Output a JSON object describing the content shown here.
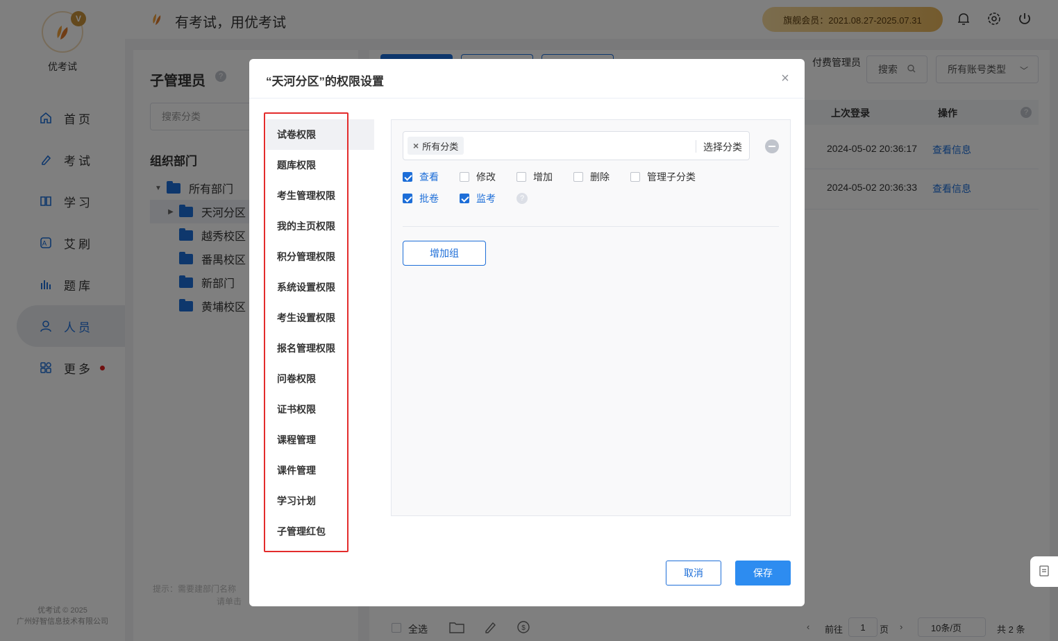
{
  "app": {
    "logo_text": "优考试",
    "logo_badge": "V",
    "slogan": "有考试，用优考试",
    "vip_text": "旗舰会员：2021.08.27-2025.07.31",
    "footer_line1": "优考试 © 2025",
    "footer_line2": "广州好智信息技术有限公司"
  },
  "sidebar": {
    "items": [
      {
        "label": "首页",
        "icon": "home-icon"
      },
      {
        "label": "考试",
        "icon": "exam-icon"
      },
      {
        "label": "学习",
        "icon": "book-icon"
      },
      {
        "label": "艾刷",
        "icon": "practice-icon"
      },
      {
        "label": "题库",
        "icon": "question-bank-icon"
      },
      {
        "label": "人员",
        "icon": "user-icon",
        "active": true
      },
      {
        "label": "更多",
        "icon": "more-icon",
        "dot": true
      }
    ]
  },
  "left_panel": {
    "title": "子管理员",
    "search_placeholder": "搜索分类",
    "org_title": "组织部门",
    "tree": [
      {
        "label": "所有部门",
        "level": 0,
        "expanded": true
      },
      {
        "label": "天河分区",
        "level": 1,
        "selected": true
      },
      {
        "label": "越秀校区",
        "level": 1
      },
      {
        "label": "番禺校区",
        "level": 1
      },
      {
        "label": "新部门",
        "level": 1
      },
      {
        "label": "黄埔校区",
        "level": 1
      }
    ],
    "hint_line1": "提示：需要建部门名称",
    "hint_line2": "请单击"
  },
  "main": {
    "desc": "付费管理员",
    "search_label": "搜索",
    "account_type": "所有账号类型",
    "columns": {
      "last_login": "上次登录",
      "actions": "操作"
    },
    "rows": [
      {
        "last_login": "2024-05-02 20:36:17",
        "action": "查看信息"
      },
      {
        "last_login": "2024-05-02 20:36:33",
        "action": "查看信息"
      }
    ],
    "bottom": {
      "select_all": "全选",
      "goto": "前往",
      "page": "1",
      "page_unit": "页",
      "page_size": "10条/页",
      "total": "共 2 条"
    }
  },
  "dialog": {
    "title": "“天河分区”的权限设置",
    "menu": [
      "试卷权限",
      "题库权限",
      "考生管理权限",
      "我的主页权限",
      "积分管理权限",
      "系统设置权限",
      "考生设置权限",
      "报名管理权限",
      "问卷权限",
      "证书权限",
      "课程管理",
      "课件管理",
      "学习计划",
      "子管理红包"
    ],
    "category_tag": "所有分类",
    "category_select": "选择分类",
    "options_row1": [
      {
        "label": "查看",
        "checked": true
      },
      {
        "label": "修改",
        "checked": false
      },
      {
        "label": "增加",
        "checked": false
      },
      {
        "label": "删除",
        "checked": false
      },
      {
        "label": "管理子分类",
        "checked": false
      }
    ],
    "options_row2": [
      {
        "label": "批卷",
        "checked": true
      },
      {
        "label": "监考",
        "checked": true
      }
    ],
    "add_group": "增加组",
    "cancel": "取消",
    "save": "保存"
  }
}
